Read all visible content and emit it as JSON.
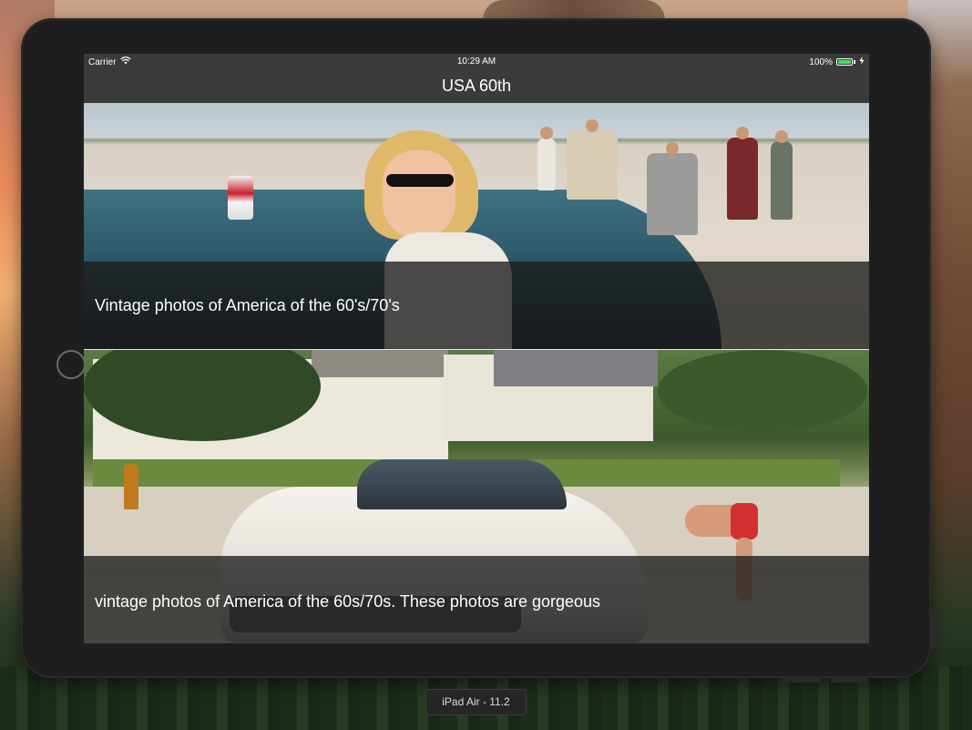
{
  "simulator": {
    "device_label": "iPad Air - 11.2"
  },
  "status_bar": {
    "carrier": "Carrier",
    "time": "10:29 AM",
    "battery_percent": "100%",
    "battery_level": 1.0
  },
  "nav": {
    "title": "USA 60th"
  },
  "feed": {
    "items": [
      {
        "caption": "Vintage photos of America of the 60's/70's"
      },
      {
        "caption": "vintage photos of America of the 60s/70s. These photos are gorgeous"
      }
    ]
  },
  "colors": {
    "bar_background": "#3b3b3b",
    "battery_green": "#4cd964",
    "device_bezel": "#1e1e1e"
  },
  "icons": {
    "wifi": "wifi-icon",
    "battery": "battery-icon",
    "charging": "charging-bolt-icon"
  }
}
